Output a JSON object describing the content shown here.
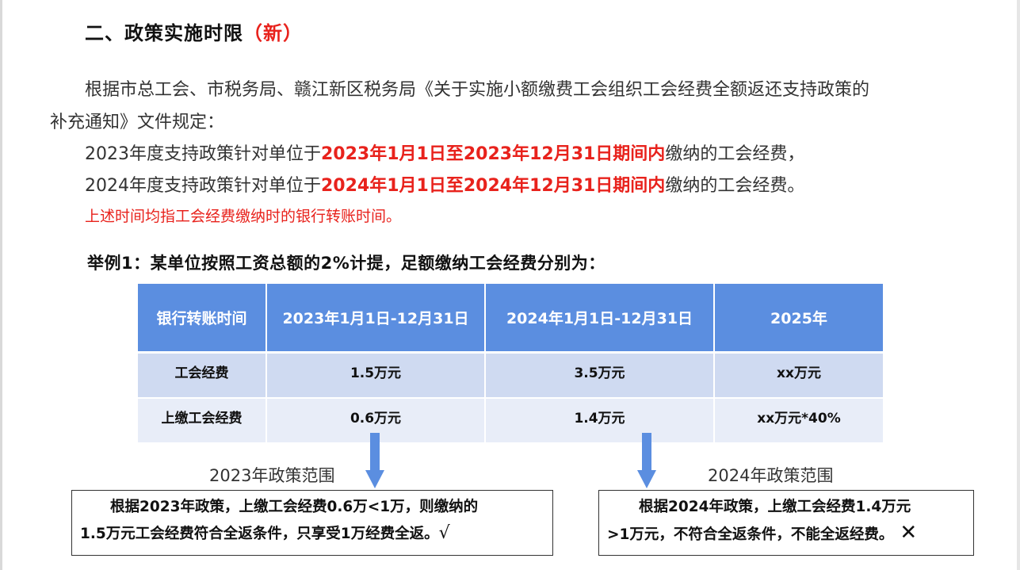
{
  "title": {
    "main": "二、政策实施时限",
    "tag": "（新）"
  },
  "intro": {
    "line1": "根据市总工会、市税务局、赣江新区税务局《关于实施小额缴费工会组织工会经费全额返还支持政策的",
    "line2": "补充通知》文件规定："
  },
  "policy2023": {
    "prefix": "2023年度支持政策针对单位于",
    "highlight": "2023年1月1日至2023年12月31日期间内",
    "suffix": "缴纳的工会经费，"
  },
  "policy2024": {
    "prefix": "2024年度支持政策针对单位于",
    "highlight": "2024年1月1日至2024年12月31日期间内",
    "suffix": "缴纳的工会经费。"
  },
  "note": "上述时间均指工会经费缴纳时的银行转账时间。",
  "example_title": "举例1：某单位按照工资总额的2%计提，足额缴纳工会经费分别为：",
  "table": {
    "headers": [
      "银行转账时间",
      "2023年1月1日-12月31日",
      "2024年1月1日-12月31日",
      "2025年"
    ],
    "rows": [
      [
        "工会经费",
        "1.5万元",
        "3.5万元",
        "xx万元"
      ],
      [
        "上缴工会经费",
        "0.6万元",
        "1.4万元",
        "xx万元*40%"
      ]
    ]
  },
  "scope2023": "2023年政策范围",
  "scope2024": "2024年政策范围",
  "box2023": {
    "line1": "根据2023年政策，上缴工会经费0.6万<1万，则缴纳的",
    "line2": "1.5万元工会经费符合全返条件，只享受1万经费全返。",
    "mark": "√"
  },
  "box2024": {
    "line1": "根据2024年政策，上缴工会经费1.4万元",
    "line2": ">1万元，不符合全返条件，不能全返经费。",
    "mark": "✕"
  },
  "colors": {
    "accent_red": "#e8221c",
    "header_blue": "#5b8ee0",
    "row_light": "#cfdaf1",
    "row_lighter": "#e8edf8",
    "arrow_blue": "#5b8ee0"
  }
}
